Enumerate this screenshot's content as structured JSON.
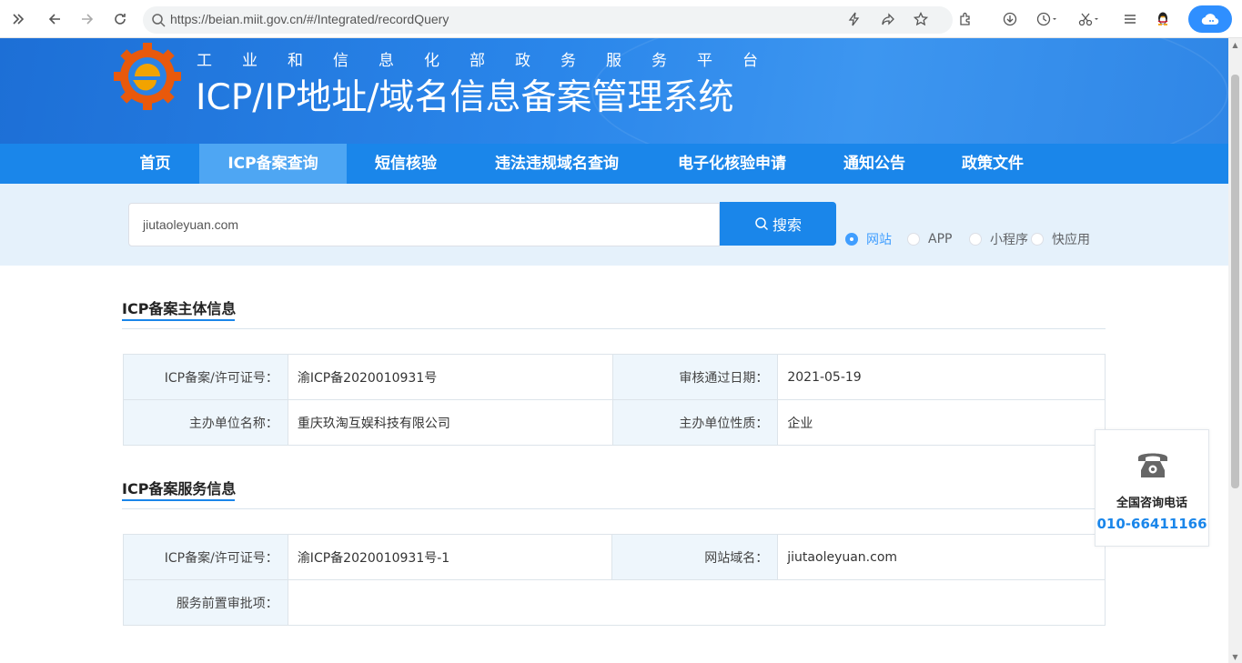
{
  "browser": {
    "url": "https://beian.miit.gov.cn/#/Integrated/recordQuery",
    "icons": [
      "sidebar-toggle-icon",
      "back-icon",
      "forward-icon",
      "reload-icon",
      "search-icon",
      "lightning-icon",
      "share-icon",
      "star-icon",
      "extensions-icon",
      "download-icon",
      "history-icon",
      "scissors-icon",
      "menu-icon",
      "qq-penguin-icon",
      "cloud-icon"
    ]
  },
  "header": {
    "subtitle": "工业和信息化部政务服务平台",
    "title": "ICP/IP地址/域名信息备案管理系统"
  },
  "nav": {
    "items": [
      "首页",
      "ICP备案查询",
      "短信核验",
      "违法违规域名查询",
      "电子化核验申请",
      "通知公告",
      "政策文件"
    ],
    "active_index": 1
  },
  "search": {
    "value": "jiutaoleyuan.com",
    "button_label": "搜索",
    "options": [
      "网站",
      "APP",
      "小程序",
      "快应用"
    ],
    "selected": "网站"
  },
  "entity_section": {
    "title": "ICP备案主体信息",
    "rows": [
      {
        "label1": "ICP备案/许可证号：",
        "value1": "渝ICP备2020010931号",
        "label2": "审核通过日期：",
        "value2": "2021-05-19"
      },
      {
        "label1": "主办单位名称：",
        "value1": "重庆玖淘互娱科技有限公司",
        "label2": "主办单位性质：",
        "value2": "企业"
      }
    ]
  },
  "service_section": {
    "title": "ICP备案服务信息",
    "rows": [
      {
        "label1": "ICP备案/许可证号：",
        "value1": "渝ICP备2020010931号-1",
        "label2": "网站域名：",
        "value2": "jiutaoleyuan.com"
      },
      {
        "label1": "服务前置审批项：",
        "value1": ""
      }
    ]
  },
  "hotline": {
    "title": "全国咨询电话",
    "number": "010-66411166"
  },
  "colors": {
    "primary": "#1a86ea",
    "nav_active": "#4ea6f3",
    "search_bg": "#e5f1fb",
    "radio_selected": "#409eff"
  }
}
